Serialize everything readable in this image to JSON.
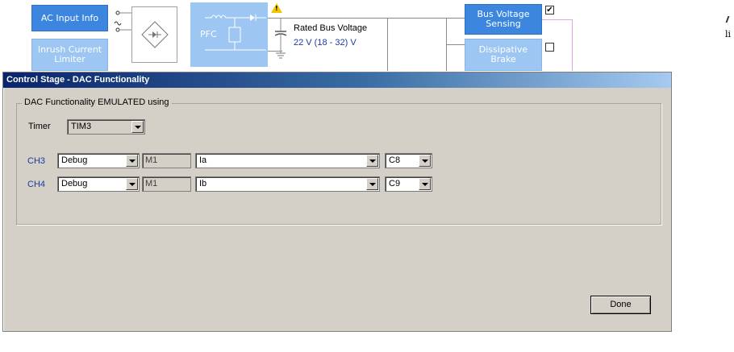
{
  "diagram": {
    "ac_input_label": "AC Input Info",
    "inrush_label": "Inrush Current Limiter",
    "pfc_label": "PFC",
    "rated_bus_label": "Rated Bus Voltage",
    "rated_bus_value": "22 V (18 - 32) V",
    "bus_sensing_label": "Bus Voltage Sensing",
    "dissipative_label": "Dissipative Brake",
    "bus_sensing_checked": "✔",
    "dissipative_checked": "",
    "right_edge_text": "li",
    "colors": {
      "dark_block": "#3d86e0",
      "light_block": "#9dc6f3",
      "value_text": "#1b3b9c"
    }
  },
  "dialog": {
    "title": "Control Stage - DAC Functionality",
    "group_label": "DAC Functionality EMULATED using",
    "timer": {
      "label": "Timer",
      "value": "TIM3"
    },
    "channels": [
      {
        "label": "CH3",
        "mode": "Debug",
        "motor": "M1",
        "signal": "Ia",
        "pin": "C8"
      },
      {
        "label": "CH4",
        "mode": "Debug",
        "motor": "M1",
        "signal": "Ib",
        "pin": "C9"
      }
    ],
    "done_label": "Done"
  }
}
